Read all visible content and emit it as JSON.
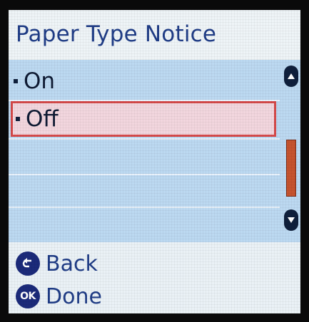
{
  "title": "Paper Type Notice",
  "options": [
    {
      "label": "On",
      "selected": false
    },
    {
      "label": "Off",
      "selected": true
    }
  ],
  "scrollbar": {
    "position": 0.65
  },
  "footer": {
    "back_label": "Back",
    "done_label": "Done",
    "done_icon_text": "OK"
  },
  "colors": {
    "title_text": "#1f3c86",
    "list_background": "#bcd9f1",
    "selection_border": "#d54a4a",
    "selection_fill": "#f2d6de",
    "scroll_thumb": "#c6532e",
    "button_icon": "#1b2a7a"
  },
  "icons": {
    "scroll_up": "scroll-up-icon",
    "scroll_down": "scroll-down-icon",
    "back": "back-arrow-icon",
    "done": "ok-button-icon"
  }
}
